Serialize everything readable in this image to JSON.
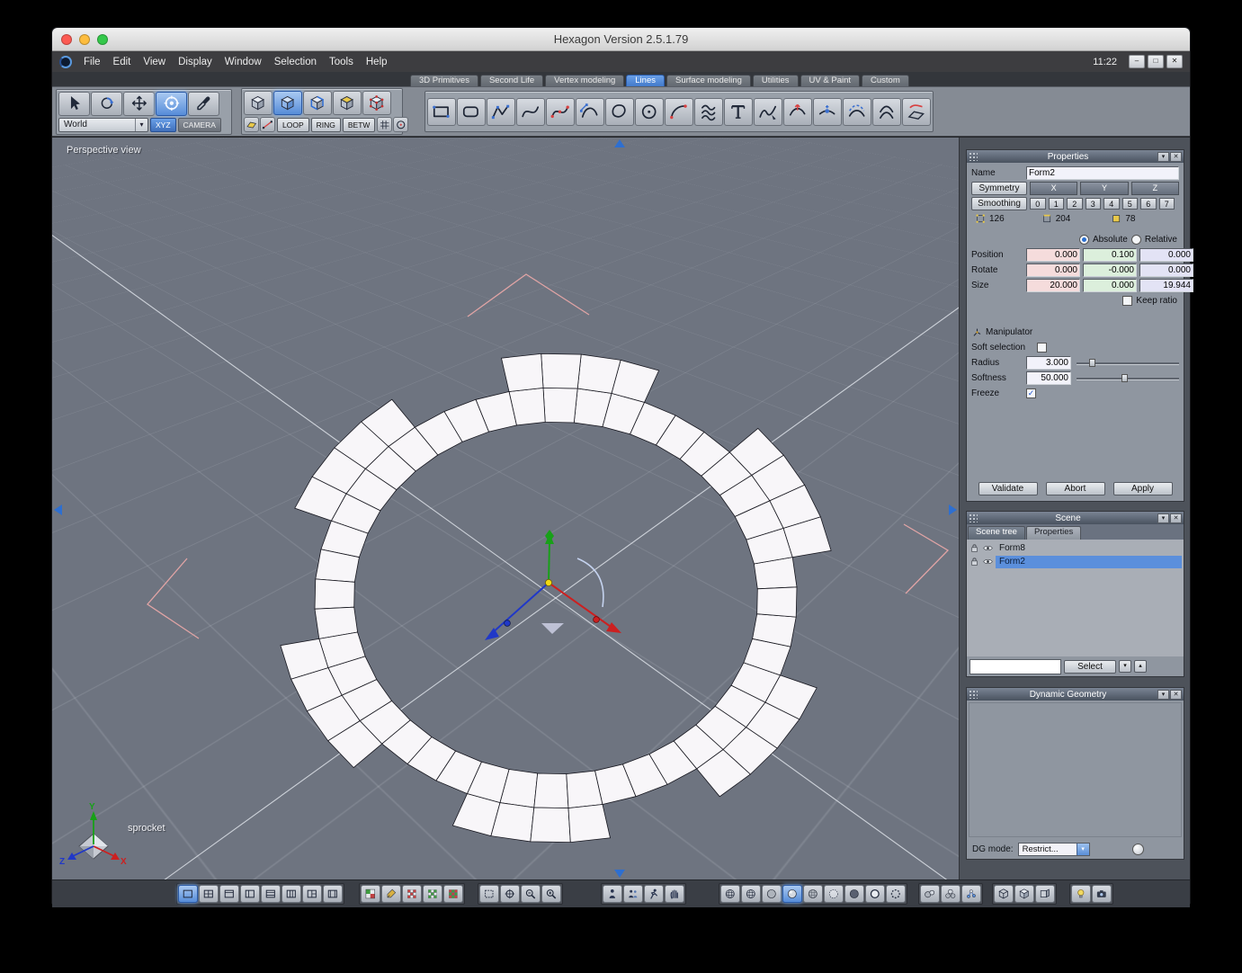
{
  "window": {
    "title": "Hexagon Version 2.5.1.79"
  },
  "menubar": {
    "items": [
      "File",
      "Edit",
      "View",
      "Display",
      "Window",
      "Selection",
      "Tools",
      "Help"
    ],
    "clock": "11:22"
  },
  "tabs": {
    "items": [
      {
        "label": "3D Primitives",
        "active": false
      },
      {
        "label": "Second Life",
        "active": false
      },
      {
        "label": "Vertex modeling",
        "active": false
      },
      {
        "label": "Lines",
        "active": true
      },
      {
        "label": "Surface modeling",
        "active": false
      },
      {
        "label": "Utilities",
        "active": false
      },
      {
        "label": "UV & Paint",
        "active": false
      },
      {
        "label": "Custom",
        "active": false
      }
    ]
  },
  "toolbar": {
    "select_group": {
      "icons": [
        "cursor-icon",
        "orbit-icon",
        "pan-icon",
        "manipulator-icon",
        "picker-icon"
      ],
      "selected_index": 3
    },
    "world_label": "World",
    "xyz_label": "XYZ",
    "camera_label": "CAMERA",
    "mode_group": {
      "icons": [
        "cube-object-icon",
        "cube-selected-icon",
        "cube-edges-icon",
        "cube-faces-icon",
        "cube-points-icon"
      ],
      "selected_index": 1
    },
    "extra_group": {
      "icons": [
        "face-mode-icon",
        "edge-mode-icon"
      ],
      "selected_index": -1
    },
    "loop_label": "LOOP",
    "ring_label": "RING",
    "betw_label": "BETW",
    "tail_group": {
      "icons": [
        "snap-grid-icon",
        "snap-circle-icon"
      ],
      "selected_index": -1
    },
    "line_tools": {
      "icons": [
        "rectangle-tool-icon",
        "rounded-rectangle-tool-icon",
        "polyline-tool-icon",
        "curve-tool-icon",
        "interpolated-curve-tool-icon",
        "bezier-curve-tool-icon",
        "closed-curve-tool-icon",
        "circle-tool-icon",
        "arc-tool-icon",
        "helix-tool-icon",
        "text-tool-icon",
        "free-curve-tool-icon",
        "curve-edit-tool-icon",
        "insert-point-tool-icon",
        "extract-curve-tool-icon",
        "offset-curve-tool-icon",
        "project-curve-tool-icon"
      ],
      "selected_index": -1
    }
  },
  "viewport": {
    "label": "Perspective view",
    "object_label": "sprocket",
    "axis": {
      "x": "X",
      "y": "Y",
      "z": "Z"
    }
  },
  "properties": {
    "title": "Properties",
    "name_label": "Name",
    "name_value": "Form2",
    "symmetry_label": "Symmetry",
    "axis_headers": [
      "X",
      "Y",
      "Z"
    ],
    "smoothing_label": "Smoothing",
    "smoothing_levels": [
      "0",
      "1",
      "2",
      "3",
      "4",
      "5",
      "6",
      "7"
    ],
    "counts": {
      "vertices": "126",
      "edges": "204",
      "faces": "78"
    },
    "absolute_label": "Absolute",
    "relative_label": "Relative",
    "position_label": "Position",
    "rotate_label": "Rotate",
    "size_label": "Size",
    "position": [
      "0.000",
      "0.100",
      "0.000"
    ],
    "rotate": [
      "0.000",
      "-0.000",
      "0.000"
    ],
    "size": [
      "20.000",
      "0.000",
      "19.944"
    ],
    "keep_ratio_label": "Keep ratio",
    "manipulator_label": "Manipulator",
    "soft_selection_label": "Soft selection",
    "radius_label": "Radius",
    "radius_value": "3.000",
    "softness_label": "Softness",
    "softness_value": "50.000",
    "freeze_label": "Freeze",
    "buttons": [
      "Validate",
      "Abort",
      "Apply"
    ]
  },
  "scene": {
    "title": "Scene",
    "tabs": [
      "Scene tree",
      "Properties"
    ],
    "items": [
      {
        "name": "Form8",
        "selected": false
      },
      {
        "name": "Form2",
        "selected": true
      }
    ],
    "select_button": "Select"
  },
  "dynamic_geometry": {
    "title": "Dynamic Geometry",
    "dg_mode_label": "DG mode:",
    "dg_mode_value": "Restrict..."
  },
  "bottom_toolbar": {
    "groups": [
      {
        "icons": [
          "layout-single-icon",
          "layout-grid4-icon",
          "layout-top-split-icon",
          "layout-left-split-icon",
          "layout-rows-icon",
          "layout-cols-icon",
          "layout-triple-icon",
          "layout-wide-icon"
        ],
        "selected_index": 0
      },
      {
        "icons": [
          "texture-checker-icon",
          "paintbrush-icon",
          "material-red-icon",
          "material-green-icon",
          "material-mixed-icon"
        ],
        "selected_index": -1
      },
      {
        "icons": [
          "select-dashed-icon",
          "gizmo-cross-icon",
          "zoom-out-icon",
          "zoom-in-icon"
        ],
        "selected_index": -1
      },
      {
        "icons": [
          "avatar-icon",
          "avatar-group-icon",
          "runner-icon",
          "grab-icon"
        ],
        "selected_index": -1
      },
      {
        "icons": [
          "sphere-wire-icon",
          "sphere-flatwire-icon",
          "sphere-flat-icon",
          "sphere-smooth-icon",
          "sphere-textured-icon",
          "sphere-ghost-icon",
          "sphere-dark-icon",
          "sphere-outline-icon",
          "sphere-points-icon"
        ],
        "selected_index": 3
      },
      {
        "icons": [
          "spheres-two-icon",
          "spheres-three-icon",
          "molecule-icon"
        ],
        "selected_index": -1
      },
      {
        "icons": [
          "cube-wire-icon",
          "cube-shaded-icon",
          "panel-box-icon"
        ],
        "selected_index": -1
      },
      {
        "icons": [
          "lamp-icon",
          "snapshot-icon"
        ],
        "selected_index": -1
      }
    ]
  },
  "colors": {
    "accent": "#4a86d8",
    "selection": "#5b8fdc",
    "viewport_bg": "#6e7480",
    "axis_x": "#cc2020",
    "axis_y": "#18a018",
    "axis_z": "#2038c8",
    "field_x": "#f5dcdc",
    "field_y": "#dcefdc",
    "field_z": "#e3e3f5"
  }
}
